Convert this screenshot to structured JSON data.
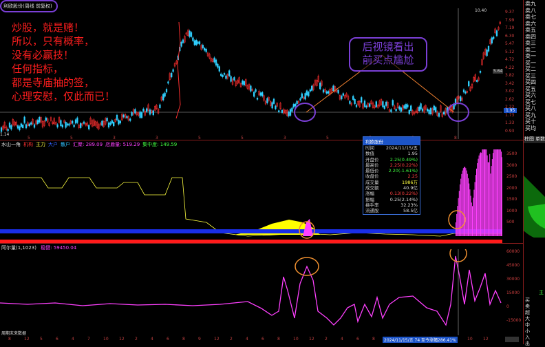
{
  "top_title": "利欧股份(周线 前复权)",
  "price_labels": {
    "high_marker": "10.40",
    "last_price": "1.95",
    "right_mark": "5.64"
  },
  "price_axis": [
    "9.37",
    "7.99",
    "7.19",
    "6.30",
    "5.47",
    "5.12",
    "4.72",
    "4.22",
    "3.82",
    "3.42",
    "3.02",
    "2.62",
    "2.22",
    "1.73",
    "1.33",
    "0.93"
  ],
  "price_axis_bottom": "1.14",
  "overlay_text": [
    "炒股，就是赌！",
    "所以，只有概率，",
    "没有必赢技！",
    "任何指标，",
    "都是寺庙抽的签，",
    "心理安慰，仅此而已！"
  ],
  "callout_text": [
    "后视镜看出",
    "前买点尴尬"
  ],
  "indicator1": {
    "name": "水山一角",
    "legend": [
      "机构 ",
      "主力 ",
      "大户 ",
      "散户 ",
      "汇聚: 289.09",
      "店盾量: 519.29",
      "集中度: 149.59"
    ],
    "legend_colors": [
      "#ff3030",
      "#ffff40",
      "#3060ff",
      "#30c0ff",
      "#ff40ff",
      "#ff40ff",
      "#40ff40"
    ],
    "axis": [
      "3500",
      "3000",
      "2500",
      "2000",
      "1500",
      "1000",
      "500"
    ]
  },
  "indicator2": {
    "name": "阿尔量(1,1023)",
    "legend": "稳健: 59450.04",
    "axis": [
      "60000",
      "45000",
      "30000",
      "15000",
      "0",
      "-15000"
    ]
  },
  "bottom_note": "周期末来数据",
  "bottom_status": "2024/11/15/五 74 至今涨幅286.41%",
  "x_ticks_bottom": [
    "8",
    "12",
    "5",
    "6",
    "4",
    "7",
    "10",
    "12",
    "2",
    "4",
    "6",
    "8",
    "9",
    "12",
    "2",
    "4",
    "6",
    "8",
    "10",
    "12",
    "2",
    "4",
    "6",
    "8",
    "10",
    "12",
    "4",
    "6",
    "7",
    "10",
    "12"
  ],
  "x_ticks_price": [
    "5",
    "5",
    "3",
    "3",
    "5",
    "5",
    "3",
    "5",
    "5",
    "8",
    "8"
  ],
  "info_box": {
    "title": "利欧股份",
    "rows": [
      {
        "k": "时间",
        "v": "2024/11/15/五",
        "c": "#ddd"
      },
      {
        "k": "数值",
        "v": "1.95",
        "c": "#ddd"
      },
      {
        "k": "开盘价",
        "v": "2.25(0.49%)",
        "c": "#40ff40"
      },
      {
        "k": "最高价",
        "v": "2.25(0.22%)",
        "c": "#ff4040"
      },
      {
        "k": "最低价",
        "v": "2.20(-1.61%)",
        "c": "#40ff40"
      },
      {
        "k": "收盘价",
        "v": "2.25",
        "c": "#ff4040"
      },
      {
        "k": "成交量",
        "v": "1986万",
        "c": "#ffff40"
      },
      {
        "k": "成交额",
        "v": "40.9亿",
        "c": "#ddd"
      },
      {
        "k": "涨幅",
        "v": "0.13(0.22%)",
        "c": "#ff4040"
      },
      {
        "k": "振幅",
        "v": "0.25(2.14%)",
        "c": "#ddd"
      },
      {
        "k": "换手率",
        "v": "32.23%",
        "c": "#ddd"
      },
      {
        "k": "流通股",
        "v": "58.5亿",
        "c": "#ddd"
      }
    ]
  },
  "sidebar": {
    "orders": [
      "卖九",
      "卖八",
      "卖七",
      "卖六",
      "卖五",
      "卖四",
      "卖三",
      "卖二",
      "卖一",
      "买一",
      "买二",
      "买三",
      "买四",
      "买五",
      "买六",
      "买七",
      "买八",
      "买九",
      "买十",
      "买均"
    ],
    "tabs": [
      "柱图",
      "单数"
    ],
    "lower_labels": [
      "买",
      "卖",
      "超",
      "大",
      "中",
      "小",
      "入",
      "出"
    ],
    "lower_head": "主"
  }
}
